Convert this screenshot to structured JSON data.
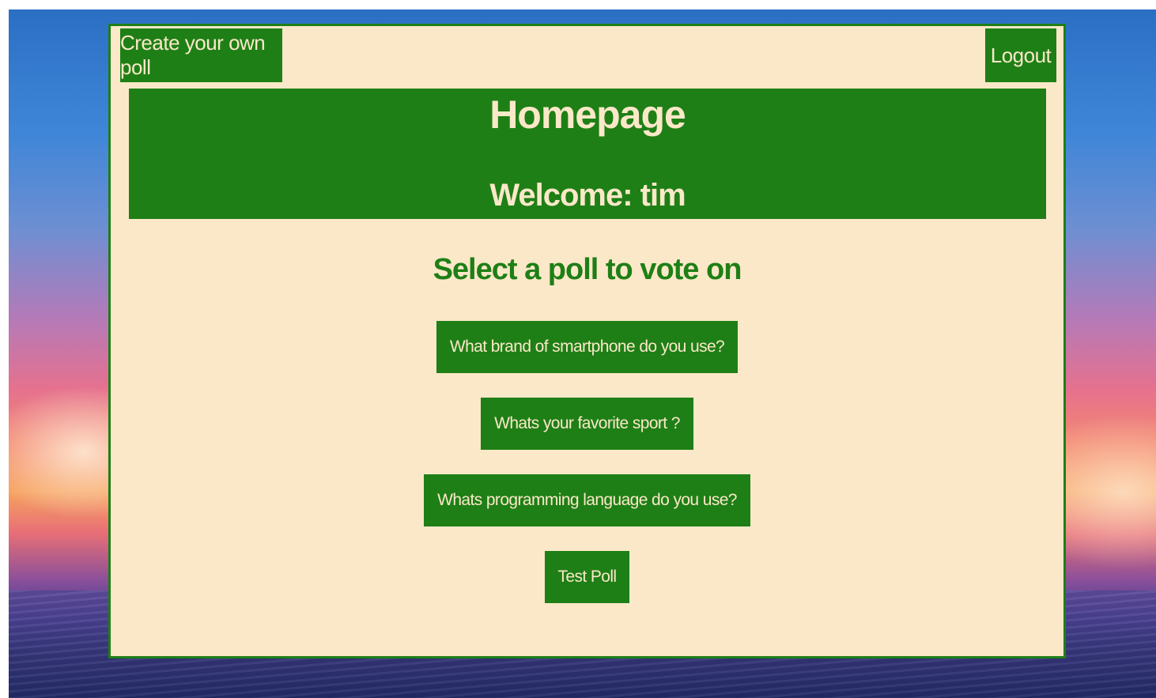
{
  "header": {
    "create_poll_label": "Create your own poll",
    "logout_label": "Logout"
  },
  "hero": {
    "title": "Homepage",
    "welcome": "Welcome: tim"
  },
  "main": {
    "subtitle": "Select a poll to vote on",
    "polls": [
      {
        "label": "What brand of smartphone do you use?"
      },
      {
        "label": "Whats your favorite sport ?"
      },
      {
        "label": "Whats programming language do you use?"
      },
      {
        "label": "Test Poll"
      }
    ]
  },
  "colors": {
    "primary_green": "#1e7f16",
    "panel_cream": "#fbe8c8"
  }
}
